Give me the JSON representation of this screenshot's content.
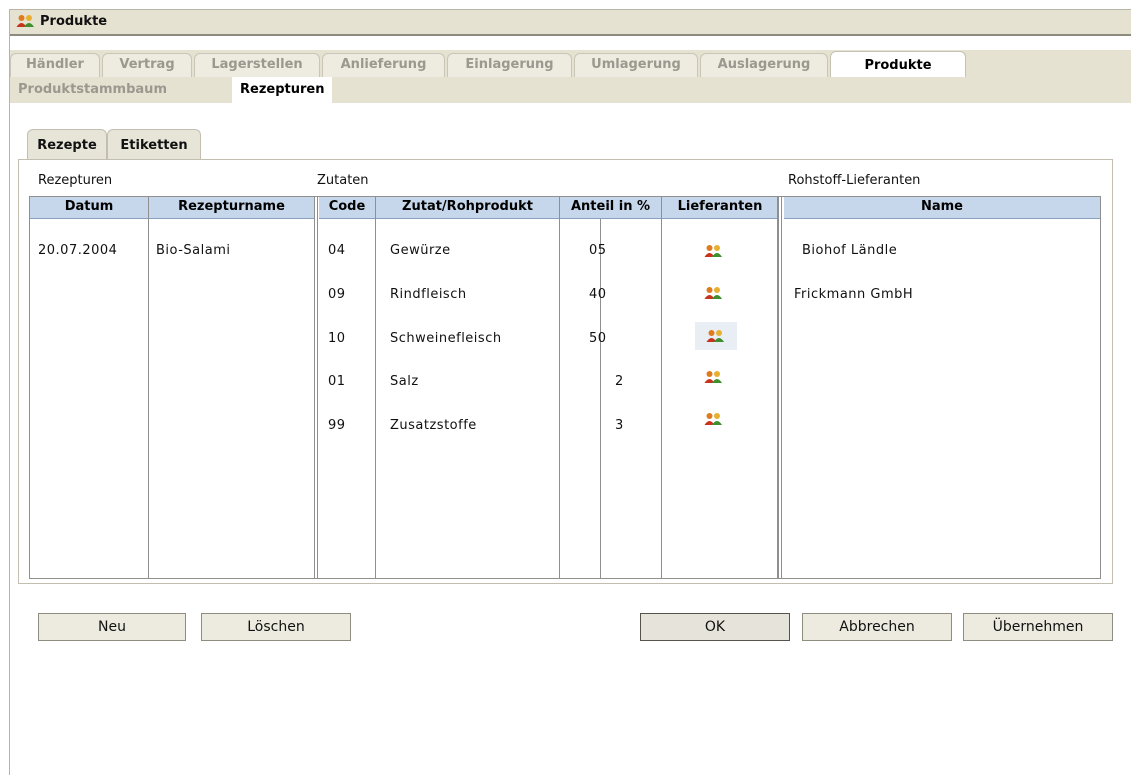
{
  "window": {
    "title": "Produkte",
    "icon": "users-icon"
  },
  "main_tabs": [
    {
      "label": "Händler"
    },
    {
      "label": "Vertrag"
    },
    {
      "label": "Lagerstellen"
    },
    {
      "label": "Anlieferung"
    },
    {
      "label": "Einlagerung"
    },
    {
      "label": "Umlagerung"
    },
    {
      "label": "Auslagerung"
    },
    {
      "label": "Produkte",
      "active": true
    }
  ],
  "sub_tabs": [
    {
      "label": "Produktstammbaum"
    },
    {
      "label": "Rezepturen",
      "active": true
    }
  ],
  "inner_tabs": [
    {
      "label": "Rezepte",
      "active": true
    },
    {
      "label": "Etiketten"
    }
  ],
  "sections": {
    "rezepturen": "Rezepturen",
    "zutaten": "Zutaten",
    "lieferanten": "Rohstoff-Lieferanten"
  },
  "columns": {
    "datum": "Datum",
    "rezepturname": "Rezepturname",
    "code": "Code",
    "zutat": "Zutat/Rohprodukt",
    "anteil": "Anteil in %",
    "lieferanten": "Lieferanten",
    "name": "Name"
  },
  "recipe": {
    "datum": "20.07.2004",
    "name": "Bio-Salami"
  },
  "ingredients": [
    {
      "code": "04",
      "name": "Gewürze",
      "anteil": "05"
    },
    {
      "code": "09",
      "name": "Rindfleisch",
      "anteil": "40"
    },
    {
      "code": "10",
      "name": "Schweinefleisch",
      "anteil": "50"
    },
    {
      "code": "01",
      "name": "Salz",
      "anteil": "2"
    },
    {
      "code": "99",
      "name": "Zusatzstoffe",
      "anteil": "3"
    }
  ],
  "suppliers": [
    {
      "name": "Biohof Ländle"
    },
    {
      "name": "Frickmann GmbH"
    }
  ],
  "buttons": {
    "neu": "Neu",
    "loeschen": "Löschen",
    "ok": "OK",
    "abbrechen": "Abbrechen",
    "uebernehmen": "Übernehmen"
  }
}
